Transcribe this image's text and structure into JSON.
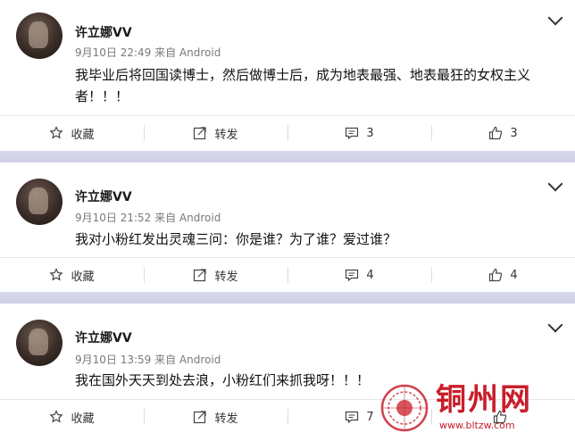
{
  "posts": [
    {
      "user": "许立娜VV",
      "meta": "9月10日 22:49 来自 Android",
      "text": "我毕业后将回国读博士，然后做博士后，成为地表最强、地表最狂的女权主义者！！！",
      "actions": {
        "favorite": "收藏",
        "repost": "转发",
        "comments": "3",
        "likes": "3"
      }
    },
    {
      "user": "许立娜VV",
      "meta": "9月10日 21:52 来自 Android",
      "text": "我对小粉红发出灵魂三问：你是谁？为了谁？爱过谁？",
      "actions": {
        "favorite": "收藏",
        "repost": "转发",
        "comments": "4",
        "likes": "4"
      }
    },
    {
      "user": "许立娜VV",
      "meta": "9月10日 13:59 来自 Android",
      "text": "我在国外天天到处去浪，小粉红们来抓我呀！！！",
      "actions": {
        "favorite": "收藏",
        "repost": "转发",
        "comments": "7",
        "likes": ""
      }
    }
  ],
  "watermark": {
    "title": "铜州网",
    "url": "www.bltzw.com"
  },
  "icons": [
    "star-icon",
    "repost-icon",
    "comment-icon",
    "like-icon",
    "chevron-down-icon"
  ],
  "colors": {
    "separator": "#d3d4e8",
    "watermark": "#c81e2a"
  }
}
